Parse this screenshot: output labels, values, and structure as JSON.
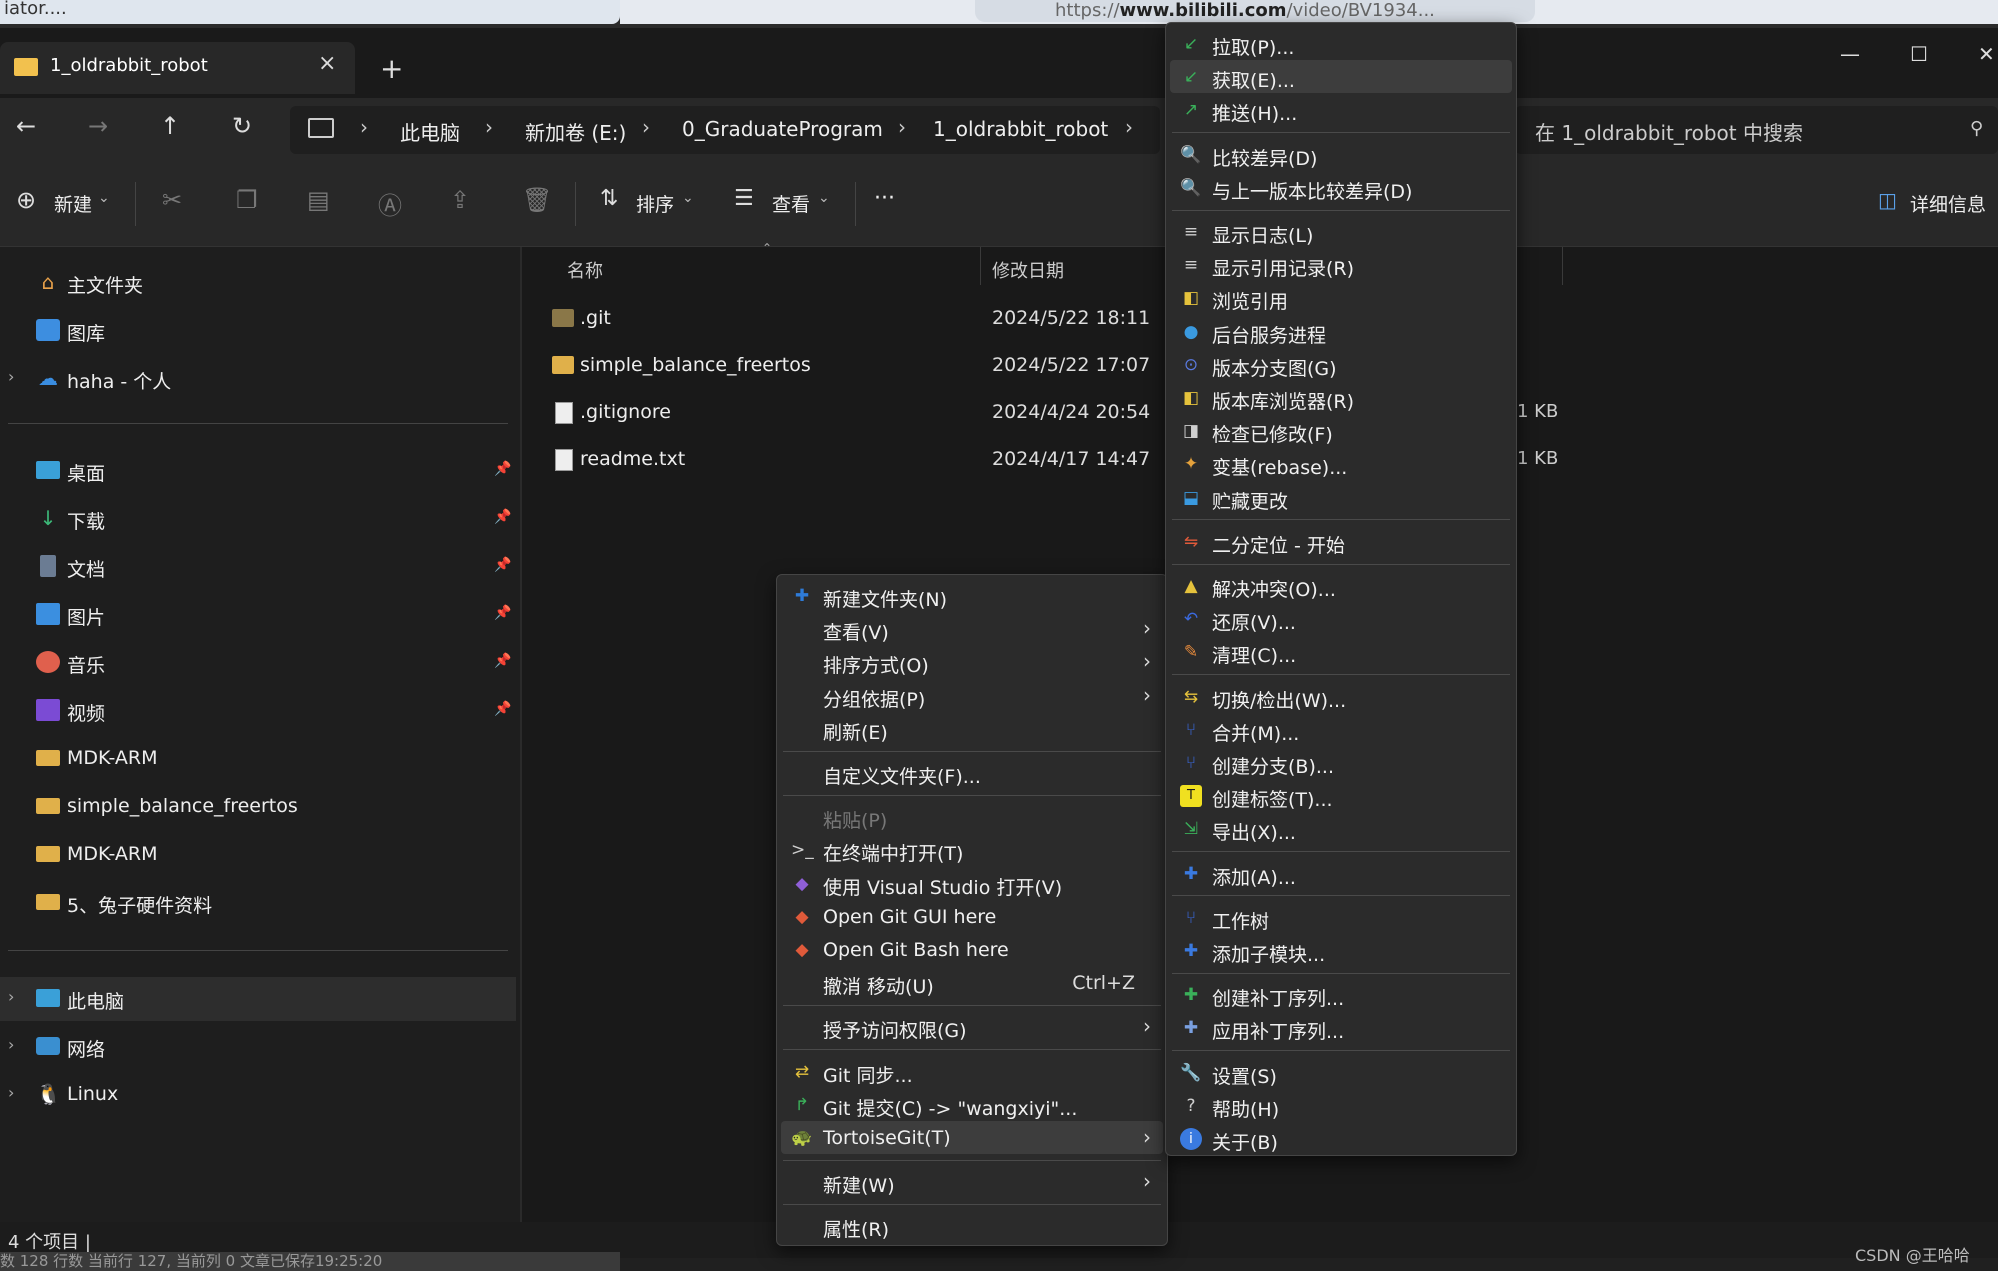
{
  "background_windows": {
    "left_tab_text": "iator....",
    "browser_url_prefix": "https://",
    "browser_url_domain": "www.bilibili.com",
    "browser_url_rest": "/video/BV1934..."
  },
  "tab": {
    "title": "1_oldrabbit_robot",
    "close": "×",
    "new": "+"
  },
  "window_controls": {
    "minimize": "—",
    "maximize": "☐",
    "close": "✕"
  },
  "nav": {
    "back": "←",
    "forward": "→",
    "up": "↑",
    "refresh": "↻"
  },
  "breadcrumb": [
    "此电脑",
    "新加卷 (E:)",
    "0_GraduateProgram",
    "1_oldrabbit_robot"
  ],
  "search": {
    "placeholder": "在 1_oldrabbit_robot 中搜索"
  },
  "toolbar": {
    "new_label": "新建",
    "sort_label": "排序",
    "view_label": "查看",
    "more_label": "···",
    "details_label": "详细信息"
  },
  "sidebar": {
    "top": [
      {
        "label": "主文件夹",
        "icon": "home-icon"
      },
      {
        "label": "图库",
        "icon": "gallery-icon"
      },
      {
        "label": "haha - 个人",
        "icon": "onedrive-icon"
      }
    ],
    "pinned": [
      {
        "label": "桌面",
        "icon": "desktop-icon"
      },
      {
        "label": "下载",
        "icon": "download-icon"
      },
      {
        "label": "文档",
        "icon": "document-icon"
      },
      {
        "label": "图片",
        "icon": "picture-icon"
      },
      {
        "label": "音乐",
        "icon": "music-icon"
      },
      {
        "label": "视频",
        "icon": "video-icon"
      },
      {
        "label": "MDK-ARM",
        "icon": "folder-icon"
      },
      {
        "label": "simple_balance_freertos",
        "icon": "folder-icon"
      },
      {
        "label": "MDK-ARM",
        "icon": "folder-icon"
      },
      {
        "label": "5、兔子硬件资料",
        "icon": "folder-icon"
      }
    ],
    "bottom": [
      {
        "label": "此电脑",
        "icon": "computer-icon"
      },
      {
        "label": "网络",
        "icon": "network-icon"
      },
      {
        "label": "Linux",
        "icon": "linux-icon"
      }
    ]
  },
  "columns": {
    "name": "名称",
    "modified": "修改日期"
  },
  "files": [
    {
      "name": ".git",
      "date": "2024/5/22 18:11",
      "size": "",
      "type": "folder-hidden"
    },
    {
      "name": "simple_balance_freertos",
      "date": "2024/5/22 17:07",
      "size": "",
      "type": "folder"
    },
    {
      "name": ".gitignore",
      "date": "2024/4/24 20:54",
      "size": "1 KB",
      "type": "file"
    },
    {
      "name": "readme.txt",
      "date": "2024/4/17 14:47",
      "size": "1 KB",
      "type": "text"
    }
  ],
  "status": {
    "count": "4 个项目",
    "cursor": "|"
  },
  "bottom_strip": "数 128 行数 当前行 127, 当前列 0 文章已保存19:25:20",
  "watermark": "CSDN @王哈哈",
  "context_menu": {
    "items": [
      {
        "label": "新建文件夹(N)",
        "icon": "new-folder-icon"
      },
      {
        "label": "查看(V)",
        "arrow": "›"
      },
      {
        "label": "排序方式(O)",
        "arrow": "›"
      },
      {
        "label": "分组依据(P)",
        "arrow": "›"
      },
      {
        "label": "刷新(E)"
      },
      {
        "sep": true
      },
      {
        "label": "自定义文件夹(F)..."
      },
      {
        "sep": true
      },
      {
        "label": "粘贴(P)",
        "disabled": true
      },
      {
        "label": "在终端中打开(T)",
        "icon": "terminal-icon"
      },
      {
        "label": "使用 Visual Studio 打开(V)",
        "icon": "visual-studio-icon"
      },
      {
        "label": "Open Git GUI here",
        "icon": "git-gui-icon"
      },
      {
        "label": "Open Git Bash here",
        "icon": "git-bash-icon"
      },
      {
        "label": "撤消 移动(U)",
        "shortcut": "Ctrl+Z"
      },
      {
        "sep": true
      },
      {
        "label": "授予访问权限(G)",
        "arrow": "›"
      },
      {
        "sep": true
      },
      {
        "label": "Git 同步...",
        "icon": "git-sync-icon"
      },
      {
        "label": "Git 提交(C) -> \"wangxiyi\"...",
        "icon": "git-commit-icon"
      },
      {
        "label": "TortoiseGit(T)",
        "icon": "tortoisegit-icon",
        "arrow": "›",
        "highlight": true
      },
      {
        "sep": true
      },
      {
        "label": "新建(W)",
        "arrow": "›"
      },
      {
        "sep": true
      },
      {
        "label": "属性(R)"
      }
    ]
  },
  "submenu": {
    "items": [
      {
        "label": "拉取(P)...",
        "icon": "pull-icon"
      },
      {
        "label": "获取(E)...",
        "icon": "fetch-icon",
        "highlight": true
      },
      {
        "label": "推送(H)...",
        "icon": "push-icon"
      },
      {
        "sep": true
      },
      {
        "label": "比较差异(D)",
        "icon": "diff-icon"
      },
      {
        "label": "与上一版本比较差异(D)",
        "icon": "diff-previous-icon"
      },
      {
        "sep": true
      },
      {
        "label": "显示日志(L)",
        "icon": "log-icon"
      },
      {
        "label": "显示引用记录(R)",
        "icon": "reflog-icon"
      },
      {
        "label": "浏览引用",
        "icon": "browse-refs-icon"
      },
      {
        "label": "后台服务进程",
        "icon": "daemon-icon"
      },
      {
        "label": "版本分支图(G)",
        "icon": "revision-graph-icon"
      },
      {
        "label": "版本库浏览器(R)",
        "icon": "repo-browser-icon"
      },
      {
        "label": "检查已修改(F)",
        "icon": "check-modifications-icon"
      },
      {
        "label": "变基(rebase)...",
        "icon": "rebase-icon"
      },
      {
        "label": "贮藏更改",
        "icon": "stash-icon"
      },
      {
        "sep": true
      },
      {
        "label": "二分定位 - 开始",
        "icon": "bisect-icon"
      },
      {
        "sep": true
      },
      {
        "label": "解决冲突(O)...",
        "icon": "resolve-icon"
      },
      {
        "label": "还原(V)...",
        "icon": "revert-icon"
      },
      {
        "label": "清理(C)...",
        "icon": "cleanup-icon"
      },
      {
        "sep": true
      },
      {
        "label": "切换/检出(W)...",
        "icon": "switch-icon"
      },
      {
        "label": "合并(M)...",
        "icon": "merge-icon"
      },
      {
        "label": "创建分支(B)...",
        "icon": "branch-icon"
      },
      {
        "label": "创建标签(T)...",
        "icon": "tag-icon"
      },
      {
        "label": "导出(X)...",
        "icon": "export-icon"
      },
      {
        "sep": true
      },
      {
        "label": "添加(A)...",
        "icon": "add-icon"
      },
      {
        "sep": true
      },
      {
        "label": "工作树",
        "icon": "worktree-icon"
      },
      {
        "label": "添加子模块...",
        "icon": "submodule-add-icon"
      },
      {
        "sep": true
      },
      {
        "label": "创建补丁序列...",
        "icon": "create-patch-icon"
      },
      {
        "label": "应用补丁序列...",
        "icon": "apply-patch-icon"
      },
      {
        "sep": true
      },
      {
        "label": "设置(S)",
        "icon": "settings-icon"
      },
      {
        "label": "帮助(H)",
        "icon": "help-icon"
      },
      {
        "label": "关于(B)",
        "icon": "about-icon"
      }
    ]
  }
}
